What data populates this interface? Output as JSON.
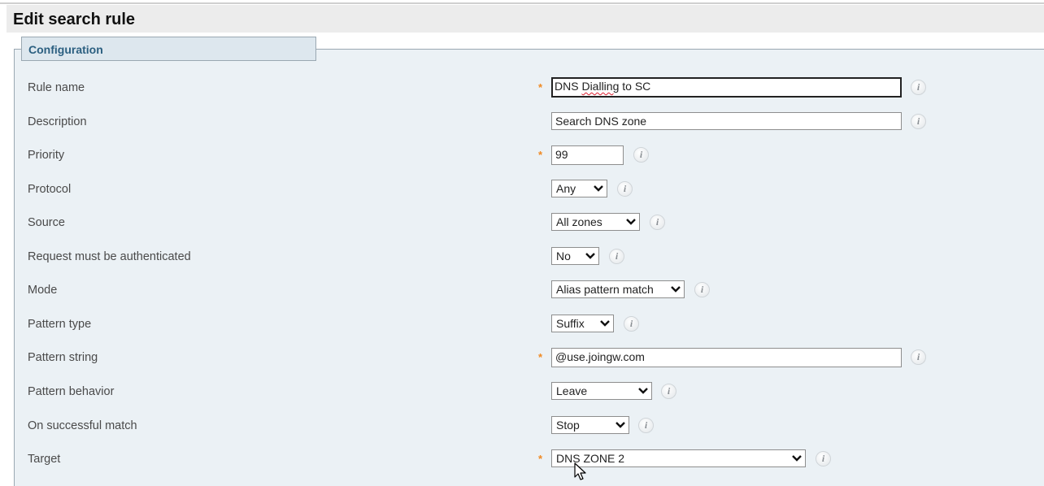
{
  "page": {
    "title": "Edit search rule"
  },
  "panel": {
    "title": "Configuration"
  },
  "fields": {
    "rule_name": {
      "label": "Rule name",
      "value_part1": "DNS ",
      "value_misspelled": "Dialling",
      "value_part2": " to SC",
      "required": true
    },
    "description": {
      "label": "Description",
      "value": "Search DNS zone"
    },
    "priority": {
      "label": "Priority",
      "value": "99",
      "required": true
    },
    "protocol": {
      "label": "Protocol",
      "value": "Any"
    },
    "source": {
      "label": "Source",
      "value": "All zones"
    },
    "auth": {
      "label": "Request must be authenticated",
      "value": "No"
    },
    "mode": {
      "label": "Mode",
      "value": "Alias pattern match"
    },
    "pattern_type": {
      "label": "Pattern type",
      "value": "Suffix"
    },
    "pattern_string": {
      "label": "Pattern string",
      "value": "@use.joingw.com",
      "required": true
    },
    "pattern_behavior": {
      "label": "Pattern behavior",
      "value": "Leave"
    },
    "on_match": {
      "label": "On successful match",
      "value": "Stop"
    },
    "target": {
      "label": "Target",
      "value": "DNS ZONE 2",
      "required": true
    }
  },
  "glyphs": {
    "required_marker": "*",
    "info": "i"
  },
  "icons": {
    "info": "info-icon",
    "dropdown": "chevron-down-icon",
    "cursor": "mouse-pointer-icon"
  },
  "colors": {
    "required": "#f08a24",
    "panel_bg": "#ebf1f5",
    "panel_title": "#2b5f80"
  }
}
